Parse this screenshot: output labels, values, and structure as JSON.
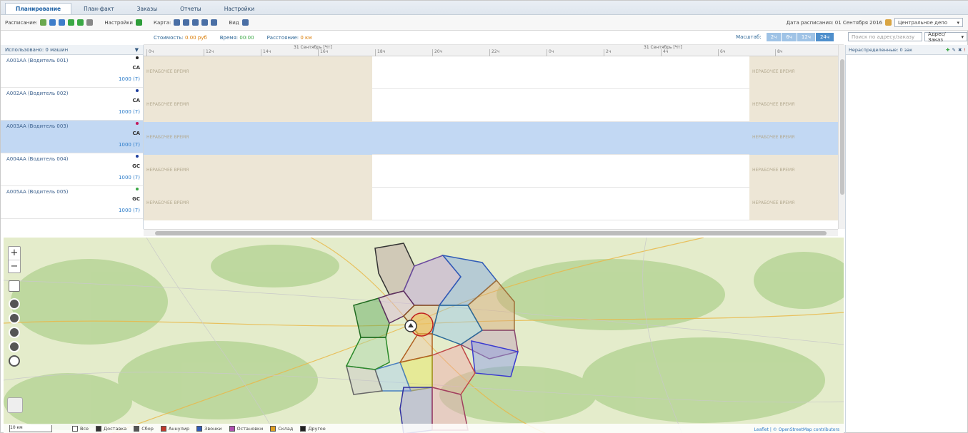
{
  "tabs": [
    {
      "label": "Планирование",
      "active": true
    },
    {
      "label": "План-факт",
      "active": false
    },
    {
      "label": "Заказы",
      "active": false
    },
    {
      "label": "Отчеты",
      "active": false
    },
    {
      "label": "Настройки",
      "active": false
    }
  ],
  "toolbar": {
    "schedule_label": "Расписание:",
    "settings_label": "Настройки",
    "map_label": "Карта:",
    "view_label": "Вид",
    "date_label": "Дата расписания: 01 Сентября 2016",
    "depot_select": "Центральное депо"
  },
  "infobar": {
    "cost_label": "Стоимость:",
    "cost_value": "0.00 руб",
    "time_label": "Время:",
    "time_value": "00:00",
    "distance_label": "Расстояние:",
    "distance_value": "0 км",
    "scale_label": "Масштаб:",
    "scale_options": [
      "2ч",
      "6ч",
      "12ч",
      "24ч"
    ],
    "scale_selected": "24ч"
  },
  "left_panel": {
    "header": "Использовано: 0 машин"
  },
  "vehicles": [
    {
      "name": "А001АА (Водитель 001)",
      "code": "CA",
      "count": "1000 (7)",
      "dot_color": "#222222",
      "selected": false
    },
    {
      "name": "А002АА (Водитель 002)",
      "code": "CA",
      "count": "1000 (7)",
      "dot_color": "#1f3f9e",
      "selected": false
    },
    {
      "name": "А003АА (Водитель 003)",
      "code": "CA",
      "count": "1000 (7)",
      "dot_color": "#c2185b",
      "selected": true
    },
    {
      "name": "А004АА (Водитель 004)",
      "code": "GC",
      "count": "1000 (7)",
      "dot_color": "#1f3f9e",
      "selected": false
    },
    {
      "name": "А005АА (Водитель 005)",
      "code": "GC",
      "count": "1000 (7)",
      "dot_color": "#3aa845",
      "selected": false
    }
  ],
  "timeline": {
    "day_labels": [
      "31 Сентябрь [Чт]",
      "31 Сентябрь [Чт]"
    ],
    "ticks": [
      "0ч",
      "12ч",
      "14ч",
      "16ч",
      "18ч",
      "20ч",
      "22ч",
      "0ч",
      "2ч",
      "4ч",
      "6ч",
      "8ч"
    ],
    "nonwork_label": "НЕРАБОЧЕЕ ВРЕМЯ"
  },
  "right_panel": {
    "search_placeholder": "Поиск по адресу/заказу",
    "filter_select": "Адрес/Заказ",
    "header": "Нераспределенные: 0 зак"
  },
  "map": {
    "legend": [
      {
        "label": "Все",
        "color": "#ffffff"
      },
      {
        "label": "Доставка",
        "color": "#333333"
      },
      {
        "label": "Сбор",
        "color": "#555555"
      },
      {
        "label": "Аннулир",
        "color": "#c0392b"
      },
      {
        "label": "Звонки",
        "color": "#2f5bb7"
      },
      {
        "label": "Остановки",
        "color": "#b050b0"
      },
      {
        "label": "Склад",
        "color": "#e0a020"
      },
      {
        "label": "Другое",
        "color": "#222222"
      }
    ],
    "attribution": "Leaflet | © OpenStreetMap contributors",
    "scale_text": "10 км"
  }
}
